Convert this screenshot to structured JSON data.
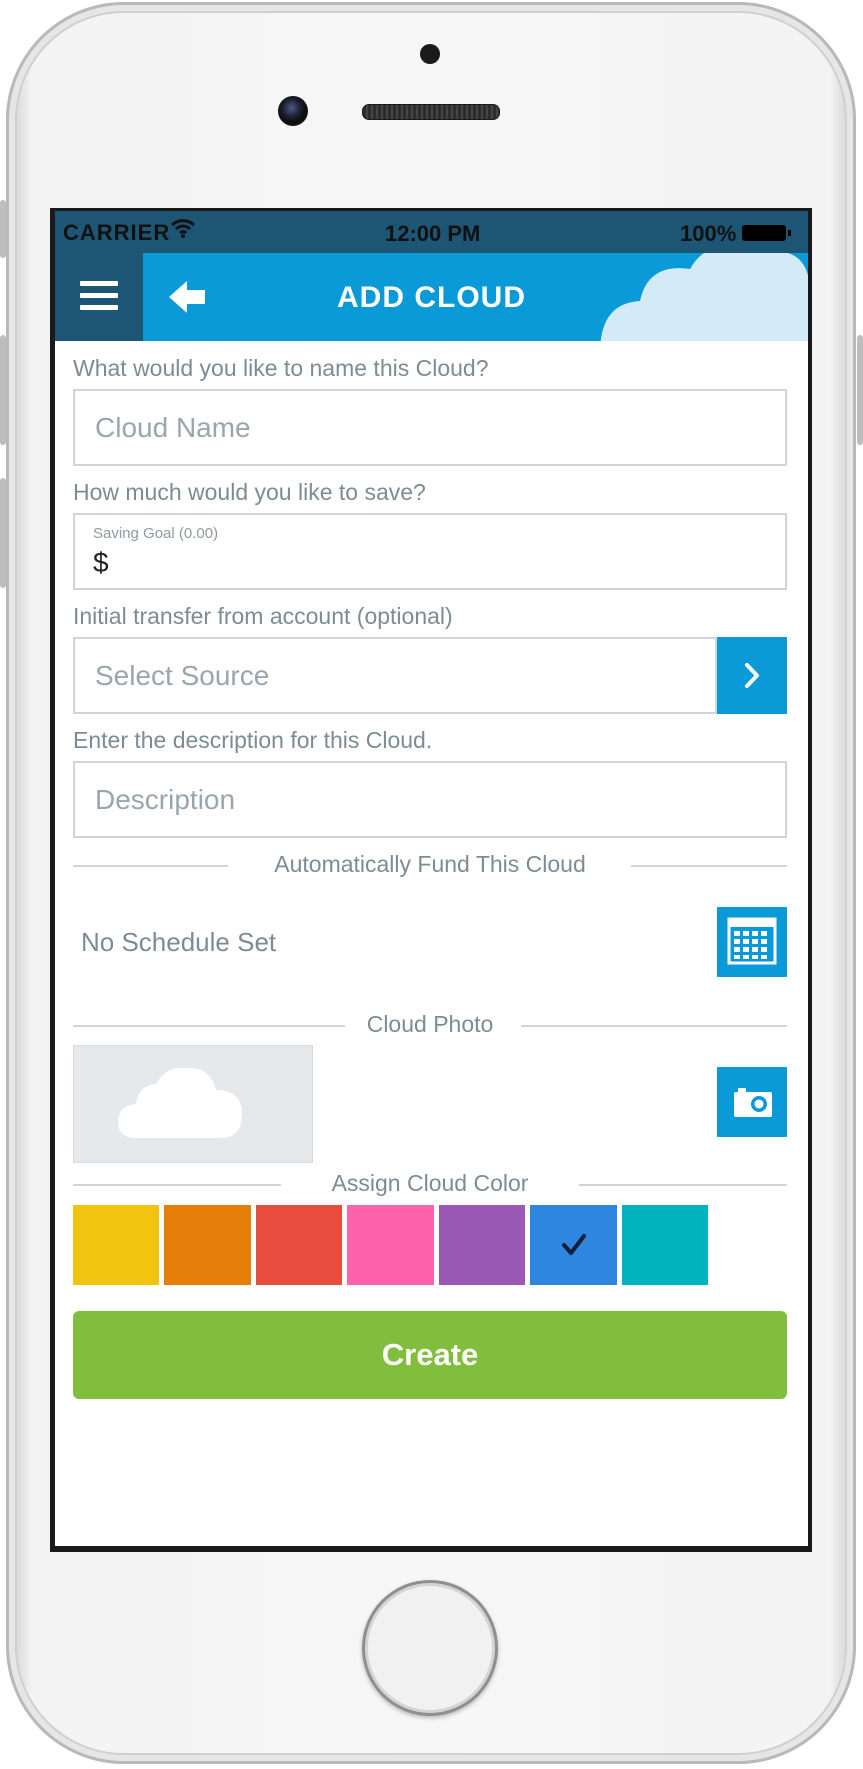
{
  "status_bar": {
    "carrier": "CARRIER",
    "time": "12:00 PM",
    "battery": "100%"
  },
  "nav": {
    "title": "ADD CLOUD",
    "menu_icon": "hamburger-icon",
    "back_icon": "back-arrow-icon"
  },
  "form": {
    "name_prompt": "What would you like to name this Cloud?",
    "name_placeholder": "Cloud Name",
    "goal_prompt": "How much would you like to save?",
    "goal_label": "Saving Goal (0.00)",
    "goal_currency": "$",
    "transfer_prompt": "Initial transfer from account (optional)",
    "source_placeholder": "Select Source",
    "description_prompt": "Enter the description for this Cloud.",
    "description_placeholder": "Description"
  },
  "auto_fund": {
    "heading": "Automatically Fund This Cloud",
    "schedule_text": "No Schedule Set",
    "icon": "calendar-icon"
  },
  "photo": {
    "heading": "Cloud Photo",
    "placeholder_icon": "cloud-icon",
    "camera_icon": "camera-icon"
  },
  "color": {
    "heading": "Assign Cloud Color",
    "swatches": [
      {
        "color": "#f1c40f",
        "selected": false
      },
      {
        "color": "#e67e0a",
        "selected": false
      },
      {
        "color": "#e74c3c",
        "selected": false
      },
      {
        "color": "#fd62ad",
        "selected": false
      },
      {
        "color": "#9b59b6",
        "selected": false
      },
      {
        "color": "#2e86de",
        "selected": true
      },
      {
        "color": "#00b3bc",
        "selected": false
      }
    ]
  },
  "actions": {
    "create_label": "Create"
  },
  "colors": {
    "brand_blue": "#0a9ad7",
    "dark_blue": "#1c5674",
    "create_green": "#82be3d"
  }
}
